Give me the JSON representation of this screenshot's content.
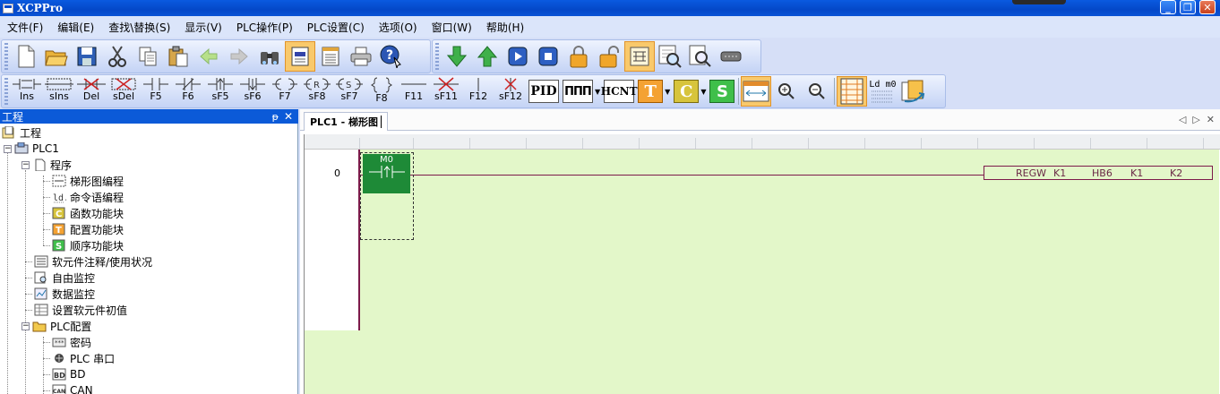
{
  "window": {
    "title": "XCPPro"
  },
  "menu": [
    "文件(F)",
    "编辑(E)",
    "查找\\替换(S)",
    "显示(V)",
    "PLC操作(P)",
    "PLC设置(C)",
    "选项(O)",
    "窗口(W)",
    "帮助(H)"
  ],
  "toolbar1": [
    "new-file",
    "open-folder",
    "save",
    "cut",
    "copy",
    "paste",
    "back",
    "forward",
    "find",
    "ladder-view",
    "list-view",
    "print",
    "help"
  ],
  "toolbar1b": [
    "download",
    "upload",
    "run",
    "stop",
    "lock",
    "unlock",
    "diagram-active",
    "monitor-view",
    "preview",
    "comm-port"
  ],
  "ladder_tools": [
    {
      "label": "Ins",
      "icon": "ins"
    },
    {
      "label": "sIns",
      "icon": "sins"
    },
    {
      "label": "Del",
      "icon": "del"
    },
    {
      "label": "sDel",
      "icon": "sdel"
    },
    {
      "label": "F5",
      "icon": "no-contact"
    },
    {
      "label": "F6",
      "icon": "nc-contact"
    },
    {
      "label": "sF5",
      "icon": "rise-contact"
    },
    {
      "label": "sF6",
      "icon": "fall-contact"
    },
    {
      "label": "F7",
      "icon": "coil"
    },
    {
      "label": "sF8",
      "icon": "reset-coil"
    },
    {
      "label": "sF7",
      "icon": "set-coil"
    },
    {
      "label": "F8",
      "icon": "bracket"
    },
    {
      "label": "F11",
      "icon": "hline"
    },
    {
      "label": "sF11",
      "icon": "delete-line"
    },
    {
      "label": "F12",
      "icon": "vline"
    },
    {
      "label": "sF12",
      "icon": "delete-vline"
    }
  ],
  "func_blocks": {
    "pid": "PID",
    "pulse": "ΠΠΠ",
    "hcnt": "HCNT",
    "t": "T",
    "c": "C",
    "s": "S"
  },
  "ldm0": "Ld m0",
  "panel": {
    "title": "工程",
    "pin": "ᵽ",
    "close": "✕"
  },
  "tree": [
    {
      "label": "工程",
      "level": 0,
      "icon": "project"
    },
    {
      "label": "PLC1",
      "level": 0,
      "icon": "plc"
    },
    {
      "label": "程序",
      "level": 1,
      "icon": "doc"
    },
    {
      "label": "梯形图编程",
      "level": 2,
      "icon": "ladder"
    },
    {
      "label": "命令语编程",
      "level": 2,
      "icon": "instr"
    },
    {
      "label": "函数功能块",
      "level": 2,
      "icon": "func-c"
    },
    {
      "label": "配置功能块",
      "level": 2,
      "icon": "func-t"
    },
    {
      "label": "顺序功能块",
      "level": 2,
      "icon": "func-s"
    },
    {
      "label": "软元件注释/使用状况",
      "level": 1,
      "icon": "list"
    },
    {
      "label": "自由监控",
      "level": 1,
      "icon": "monitor"
    },
    {
      "label": "数据监控",
      "level": 1,
      "icon": "data"
    },
    {
      "label": "设置软元件初值",
      "level": 1,
      "icon": "settings"
    },
    {
      "label": "PLC配置",
      "level": 1,
      "icon": "folder"
    },
    {
      "label": "密码",
      "level": 2,
      "icon": "password"
    },
    {
      "label": "PLC 串口",
      "level": 2,
      "icon": "serial"
    },
    {
      "label": "BD",
      "level": 2,
      "icon": "bd"
    },
    {
      "label": "CAN",
      "level": 2,
      "icon": "can"
    }
  ],
  "doc_tab": {
    "label": "PLC1 - 梯形图"
  },
  "ladder": {
    "row": "0",
    "contact": {
      "device": "M0",
      "symbol": "⊣↑⊢"
    },
    "instruction": {
      "op": "REGW",
      "args": [
        "K1",
        "HB6",
        "K1",
        "K2"
      ]
    }
  },
  "colors": {
    "accent": "#0b5ad8",
    "ladder_bg": "#e3f7c9",
    "contact": "#1e8a37",
    "rung": "#7c1a4a"
  }
}
